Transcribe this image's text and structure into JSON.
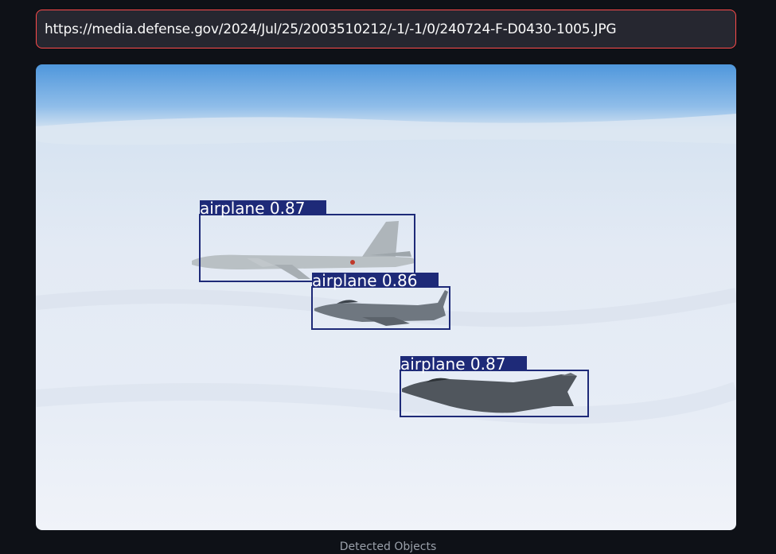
{
  "url_input": {
    "value": "https://media.defense.gov/2024/Jul/25/2003510212/-1/-1/0/240724-F-D0430-1005.JPG"
  },
  "detections": [
    {
      "label": "airplane",
      "score": "0.87",
      "text": "airplane 0.87"
    },
    {
      "label": "airplane",
      "score": "0.86",
      "text": "airplane 0.86"
    },
    {
      "label": "airplane",
      "score": "0.87",
      "text": "airplane 0.87"
    }
  ],
  "caption": "Detected Objects",
  "colors": {
    "page_background": "#0e1117",
    "input_background": "#262730",
    "input_border": "#ff4b4b",
    "box_color": "#1e2a78",
    "sky_top": "#5ea3e0",
    "cloud": "#e6ecf4"
  }
}
